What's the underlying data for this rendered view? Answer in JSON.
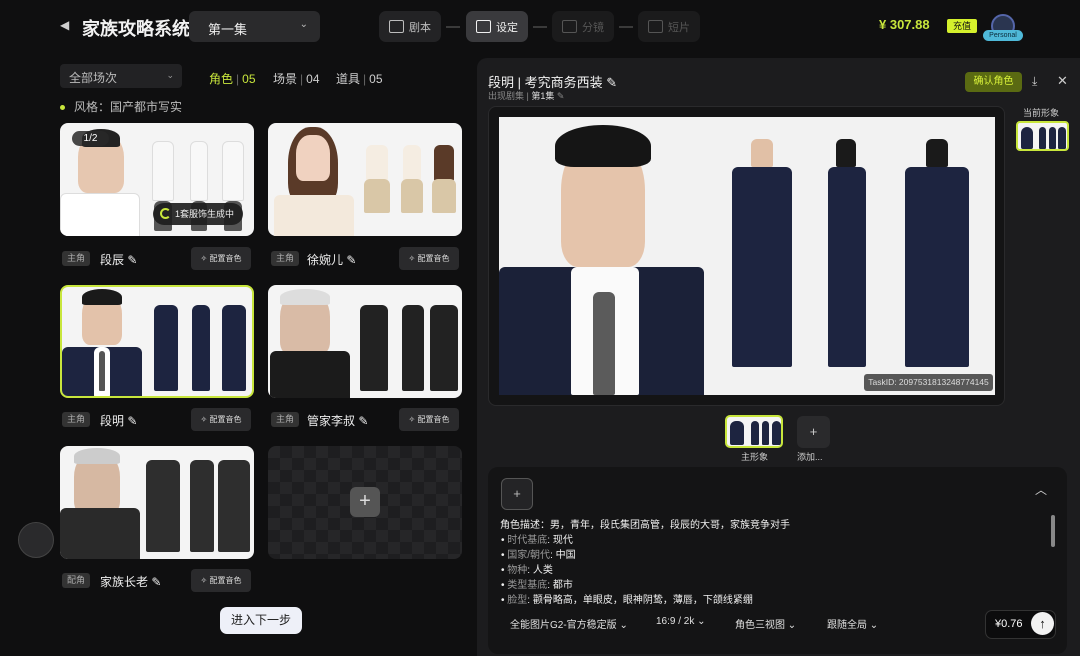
{
  "header": {
    "back": "◀",
    "title": "家族攻略系统",
    "episode": "第一集",
    "steps": [
      "剧本",
      "设定",
      "分镜",
      "短片"
    ],
    "balance": "¥ 307.88",
    "recharge": "充值",
    "avatar_label": "Personal"
  },
  "left": {
    "scene_filter": "全部场次",
    "tabs": [
      {
        "label": "角色",
        "count": "05"
      },
      {
        "label": "场景",
        "count": "04"
      },
      {
        "label": "道具",
        "count": "05"
      }
    ],
    "style": "风格：国产都市写实",
    "cards": [
      {
        "badge": "主角",
        "name": "段辰",
        "btn": "配置音色",
        "pager": "1/2",
        "gen": "1套服饰生成中"
      },
      {
        "badge": "主角",
        "name": "徐婉儿",
        "btn": "配置音色"
      },
      {
        "badge": "主角",
        "name": "段明",
        "btn": "配置音色"
      },
      {
        "badge": "主角",
        "name": "管家李叔",
        "btn": "配置音色"
      },
      {
        "badge": "配角",
        "name": "家族长老",
        "btn": "配置音色"
      }
    ],
    "next": "进入下一步",
    "plus": "+"
  },
  "right": {
    "title": "段明 | 考究商务西装",
    "source_label": "出现剧集",
    "source_value": "第1集",
    "confirm": "确认角色",
    "current_label": "当前形象",
    "task_id": "TaskID: 2097531813248774145",
    "thumb_label": "主形象",
    "add_label": "添加...",
    "desc_title": "角色描述：男，青年，段氏集团高管，段辰的大哥，家族竞争对手",
    "desc_items": [
      {
        "k": "时代基底",
        "v": "现代"
      },
      {
        "k": "国家/朝代",
        "v": "中国"
      },
      {
        "k": "物种",
        "v": "人类"
      },
      {
        "k": "类型基底",
        "v": "都市"
      },
      {
        "k": "脸型",
        "v": "颧骨略高，单眼皮，眼神阴鸷，薄唇，下颌线紧绷"
      }
    ],
    "options": [
      "全能图片G2-官方稳定版",
      "16:9 / 2k",
      "角色三视图",
      "跟随全局"
    ],
    "price": "¥0.76"
  }
}
